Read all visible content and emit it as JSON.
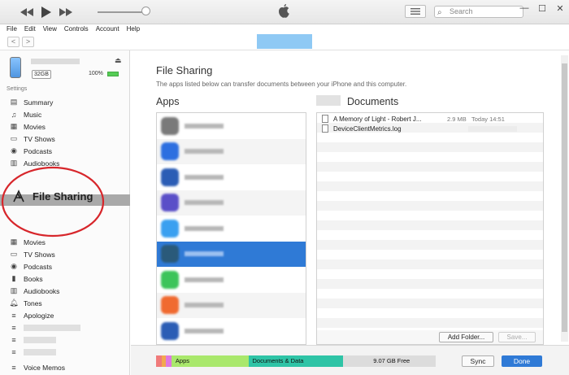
{
  "toolbar": {
    "search_placeholder": "Search",
    "window_controls": [
      "—",
      "☐",
      "✕"
    ]
  },
  "menu": [
    "File",
    "Edit",
    "View",
    "Controls",
    "Account",
    "Help"
  ],
  "device": {
    "capacity": "32GB",
    "battery": "100%"
  },
  "sidebar": {
    "settings_label": "Settings",
    "settings_items": [
      {
        "label": "Summary",
        "icon": "summary-icon"
      },
      {
        "label": "Music",
        "icon": "music-note-icon"
      },
      {
        "label": "Movies",
        "icon": "film-icon"
      },
      {
        "label": "TV Shows",
        "icon": "tv-icon"
      },
      {
        "label": "Podcasts",
        "icon": "podcast-icon"
      },
      {
        "label": "Audiobooks",
        "icon": "audiobook-icon"
      }
    ],
    "file_sharing": "File Sharing",
    "on_device_items": [
      {
        "label": "Movies",
        "icon": "film-icon"
      },
      {
        "label": "TV Shows",
        "icon": "tv-icon"
      },
      {
        "label": "Podcasts",
        "icon": "podcast-icon"
      },
      {
        "label": "Books",
        "icon": "book-icon"
      },
      {
        "label": "Audiobooks",
        "icon": "audiobook-icon"
      },
      {
        "label": "Tones",
        "icon": "bell-icon"
      },
      {
        "label": "Apologize",
        "icon": "playlist-icon"
      }
    ],
    "voice_memos": "Voice Memos"
  },
  "main": {
    "title": "File Sharing",
    "subtitle": "The apps listed below can transfer documents between your iPhone and this computer.",
    "apps_header": "Apps",
    "documents_header": "Documents",
    "documents": [
      {
        "name": "A Memory of Light - Robert J...",
        "size": "2.9 MB",
        "date": "Today 14:51"
      },
      {
        "name": "DeviceClientMetrics.log",
        "size": "",
        "date": ""
      }
    ],
    "add_folder": "Add Folder...",
    "save": "Save..."
  },
  "app_icons": [
    {
      "color": "#7a7a7a",
      "icon": "documents-app-icon"
    },
    {
      "color": "#2d6fe0",
      "icon": "browser-app-icon"
    },
    {
      "color": "#2b5db5",
      "icon": "word-app-icon"
    },
    {
      "color": "#5a4fc8",
      "icon": "app-icon"
    },
    {
      "color": "#3aa0f0",
      "icon": "keynote-app-icon"
    },
    {
      "color": "#2a5a7a",
      "icon": "app-icon"
    },
    {
      "color": "#3cc45a",
      "icon": "numbers-app-icon"
    },
    {
      "color": "#f06a30",
      "icon": "garageband-app-icon"
    },
    {
      "color": "#2b5db5",
      "icon": "word-app-icon"
    }
  ],
  "storage": {
    "segments": [
      {
        "label": "",
        "color": "#f07a7a",
        "fraction": 0.02
      },
      {
        "label": "",
        "color": "#f2a84e",
        "fraction": 0.015
      },
      {
        "label": "",
        "color": "#e078e0",
        "fraction": 0.02
      },
      {
        "label": "Apps",
        "color": "#a9e86c",
        "fraction": 0.275
      },
      {
        "label": "Documents & Data",
        "color": "#2ec4a6",
        "fraction": 0.34
      },
      {
        "label": "9.07 GB Free",
        "color": "#dcdcdc",
        "fraction": 0.33
      }
    ],
    "sync": "Sync",
    "done": "Done"
  }
}
